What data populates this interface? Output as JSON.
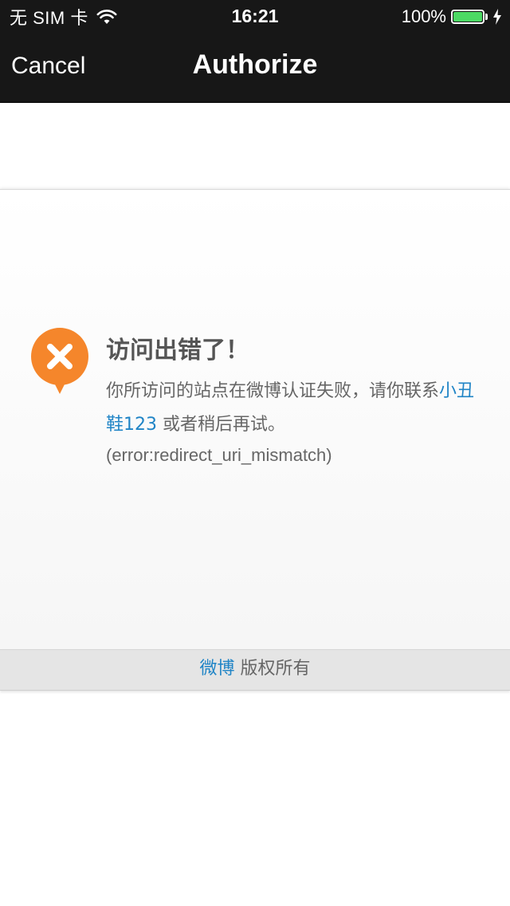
{
  "status_bar": {
    "carrier": "无 SIM 卡",
    "wifi_icon": "wifi-icon",
    "time": "16:21",
    "battery_percent": "100%",
    "battery_level": 1.0,
    "battery_color": "#4cd964",
    "charging_icon": "bolt-icon"
  },
  "nav": {
    "cancel_label": "Cancel",
    "title": "Authorize",
    "background": "#171717"
  },
  "error": {
    "icon": "error-x-icon",
    "icon_color": "#f5862b",
    "title": "访问出错了！",
    "message_prefix": "你所访问的站点在微博认证失败，请你联系",
    "contact_link": "小丑鞋123",
    "contact_link_part1": "小丑",
    "contact_link_part2": "鞋123",
    "message_suffix": " 或者稍后再试。",
    "code": "(error:redirect_uri_mismatch)",
    "link_color": "#1f84c6"
  },
  "footer": {
    "brand_link": "微博",
    "copyright": " 版权所有"
  }
}
